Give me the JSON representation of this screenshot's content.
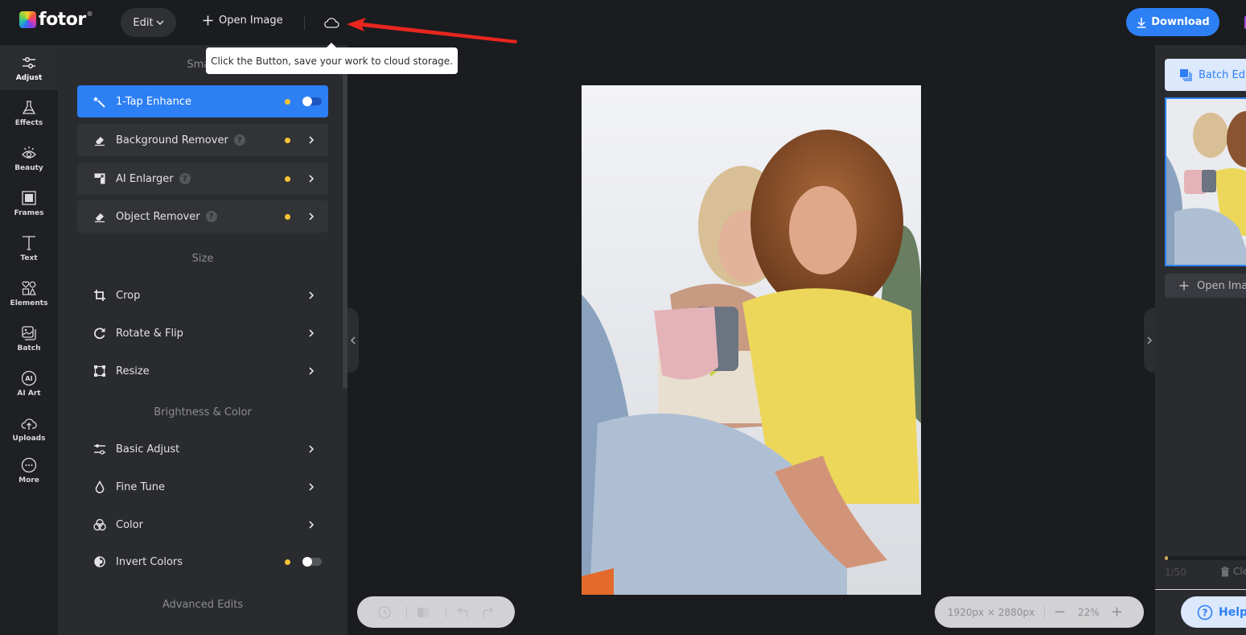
{
  "topbar": {
    "brand": "fotor",
    "brand_mark": "®",
    "edit_label": "Edit",
    "open_image_label": "Open Image",
    "cloud_tooltip": "Click the Button, save your work to cloud storage.",
    "download_label": "Download"
  },
  "leftnav": {
    "items": [
      {
        "label": "Adjust",
        "icon": "sliders-icon"
      },
      {
        "label": "Effects",
        "icon": "flask-icon"
      },
      {
        "label": "Beauty",
        "icon": "eye-icon"
      },
      {
        "label": "Frames",
        "icon": "frame-icon"
      },
      {
        "label": "Text",
        "icon": "text-icon"
      },
      {
        "label": "Elements",
        "icon": "shapes-icon"
      },
      {
        "label": "Batch",
        "icon": "batch-images-icon"
      },
      {
        "label": "AI Art",
        "icon": "ai-icon"
      },
      {
        "label": "Uploads",
        "icon": "cloud-upload-icon"
      },
      {
        "label": "More",
        "icon": "more-icon"
      }
    ],
    "active": "Adjust"
  },
  "panel": {
    "sections": {
      "smart": "Smart",
      "size": "Size",
      "brightness": "Brightness & Color",
      "advanced": "Advanced Edits"
    },
    "smart_tools": [
      {
        "label": "1-Tap Enhance",
        "premium": true,
        "control": "toggle",
        "toggle_on": false
      },
      {
        "label": "Background Remover",
        "premium": true,
        "help": "?",
        "control": "chevron"
      },
      {
        "label": "AI Enlarger",
        "premium": true,
        "help": "?",
        "control": "chevron"
      },
      {
        "label": "Object Remover",
        "premium": true,
        "help": "?",
        "control": "chevron"
      }
    ],
    "size_tools": [
      {
        "label": "Crop"
      },
      {
        "label": "Rotate & Flip"
      },
      {
        "label": "Resize"
      }
    ],
    "color_tools": [
      {
        "label": "Basic Adjust"
      },
      {
        "label": "Fine Tune"
      },
      {
        "label": "Color"
      },
      {
        "label": "Invert Colors",
        "premium": true,
        "control": "toggle",
        "toggle_on": false
      }
    ]
  },
  "canvas": {
    "dimensions": "1920px × 2880px",
    "zoom": "22%",
    "zoom_out": "−",
    "zoom_in": "+"
  },
  "rightpanel": {
    "batch_edit_label": "Batch Edit",
    "open_image_label": "Open Image",
    "count_current": "1",
    "count_total": "/50",
    "progress_fraction": 0.02,
    "clear_label": "Clear",
    "help_label": "Help"
  },
  "colors": {
    "accent": "#2d7ff4",
    "premium_dot": "#f7c437",
    "annotation_arrow": "#e8261f"
  }
}
